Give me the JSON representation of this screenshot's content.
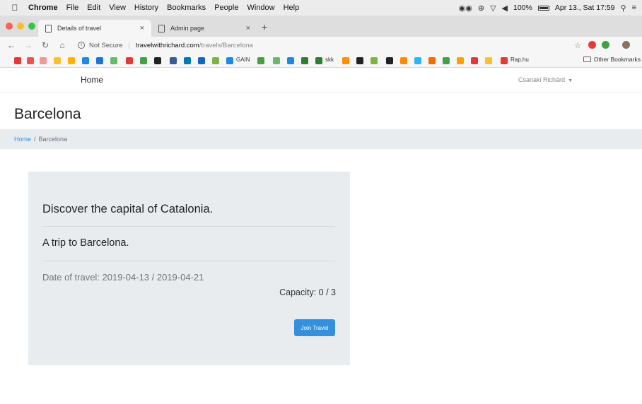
{
  "menubar": {
    "app": "Chrome",
    "items": [
      "File",
      "Edit",
      "View",
      "History",
      "Bookmarks",
      "People",
      "Window",
      "Help"
    ],
    "battery": "100%",
    "datetime": "Apr 13., Sat 17:59"
  },
  "tabs": [
    {
      "title": "Details of travel",
      "close": "×"
    },
    {
      "title": "Admin page",
      "close": "×"
    }
  ],
  "new_tab": "+",
  "address": {
    "security": "Not Secure",
    "host": "travelwithrichard.com",
    "path": "/travels/Barcelona"
  },
  "bookmarks": {
    "gain": "GAIN",
    "skk": "skk",
    "rap": "Rap.hu",
    "other": "Other Bookmarks"
  },
  "site": {
    "nav_home": "Home",
    "user": "Csanaki Richárd",
    "page_title": "Barcelona",
    "breadcrumb": {
      "home": "Home",
      "divider": "/",
      "current": "Barcelona"
    },
    "card": {
      "headline": "Discover the capital of Catalonia.",
      "subtitle": "A trip to Barcelona.",
      "dates": "Date of travel: 2019-04-13 / 2019-04-21",
      "capacity": "Capacity: 0 / 3",
      "join_button": "Join Travel"
    }
  },
  "colors": {
    "accent": "#3490dc",
    "card_bg": "#e9ecef",
    "traffic_red": "#fc5f57",
    "traffic_yellow": "#fdbc2e",
    "traffic_green": "#33c748"
  }
}
